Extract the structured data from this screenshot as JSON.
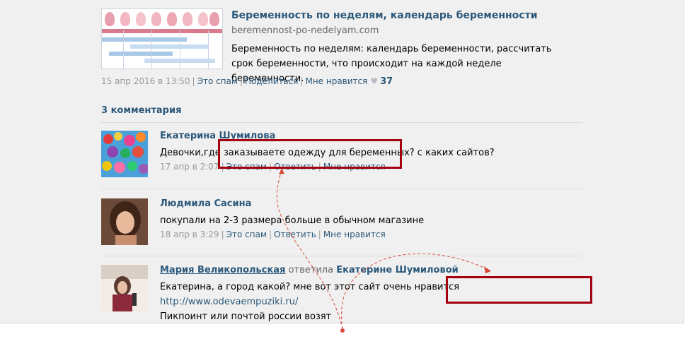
{
  "preview": {
    "title": "Беременность по неделям, календарь беременности",
    "domain": "beremennost-po-nedelyam.com",
    "description": "Беременность по неделям: календарь беременности, рассчитать срок беременности, что происходит на каждой неделе беременности."
  },
  "post_meta": {
    "date": "15 апр 2016 в 13:50",
    "spam": "Это спам",
    "share": "Поделиться",
    "like": "Мне нравится",
    "like_count": "37"
  },
  "comments_count": "3 комментария",
  "comments": [
    {
      "author": "Екатерина Шумилова",
      "text": "Девочки,где заказываете одежду для беременных? с каких сайтов?",
      "date": "17 апр в 2:07",
      "spam": "Это спам",
      "reply": "Ответить",
      "like": "Мне нравится"
    },
    {
      "author": "Людмила Сасина",
      "text": "покупали на 2-3 размера больше в обычном магазине",
      "date": "18 апр в 3:29",
      "spam": "Это спам",
      "reply": "Ответить",
      "like": "Мне нравится"
    },
    {
      "author": "Мария Великопольская",
      "replied_word": "ответила",
      "replied_to": "Екатерине Шумиловой",
      "text_before": "Екатерина, а город какой? мне вот этот сайт очень нравится ",
      "link": "http://www.odevaempuziki.ru/",
      "text_after": "Пикпоинт или почтой россии возят"
    }
  ],
  "colors": {
    "link": "#2b587a",
    "highlight": "#a4000f",
    "arrow": "#d94a3a"
  }
}
